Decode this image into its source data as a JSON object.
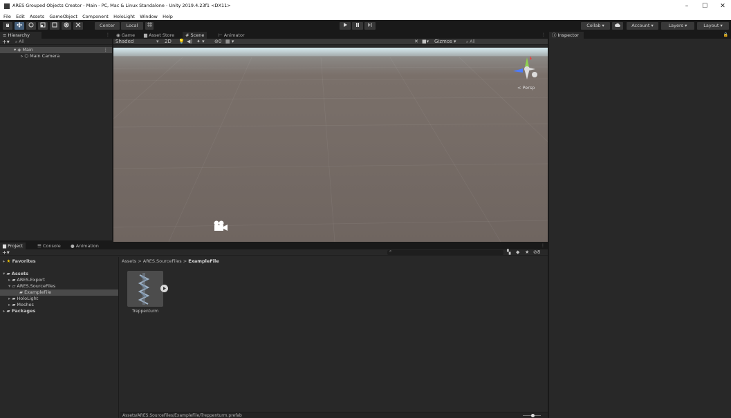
{
  "window": {
    "title": "ARES Grouped Objects Creator - Main - PC, Mac & Linux Standalone - Unity 2019.4.23f1 <DX11>",
    "minimize": "–",
    "maximize": "☐",
    "close": "✕"
  },
  "menu": [
    "File",
    "Edit",
    "Assets",
    "GameObject",
    "Component",
    "HoloLight",
    "Window",
    "Help"
  ],
  "toolbar": {
    "center_label": "Center",
    "local_label": "Local",
    "collab_label": "Collab ▾",
    "account_label": "Account",
    "layers_label": "Layers",
    "layout_label": "Layout"
  },
  "hierarchy": {
    "tab": "Hierarchy",
    "search_placeholder": "All",
    "items": [
      {
        "label": "Main"
      },
      {
        "label": "Main Camera"
      }
    ]
  },
  "scene": {
    "tabs": [
      "Game",
      "Asset Store",
      "Scene",
      "Animator"
    ],
    "shading_mode": "Shaded",
    "mode_2d": "2D",
    "fx_count": "0",
    "gizmos_label": "Gizmos",
    "search_placeholder": "All",
    "persp_label": "< Persp"
  },
  "inspector": {
    "tab": "Inspector"
  },
  "project": {
    "tabs": [
      "Project",
      "Console",
      "Animation"
    ],
    "favorites_label": "Favorites",
    "tree": [
      {
        "label": "Assets"
      },
      {
        "label": "ARES.Export"
      },
      {
        "label": "ARES.SourceFiles"
      },
      {
        "label": "ExampleFile"
      },
      {
        "label": "HoloLight"
      },
      {
        "label": "Meshes"
      },
      {
        "label": "Packages"
      }
    ],
    "breadcrumb": [
      "Assets",
      "ARES.SourceFiles",
      "ExampleFile"
    ],
    "breadcrumb_sep": ">",
    "asset_name": "Treppenturm",
    "status_path": "Assets/ARES.SourceFiles/ExampleFile/Treppenturm.prefab",
    "hidden_count": "8",
    "zoom_level": 0.55
  },
  "colors": {
    "accent": "#46607c",
    "selection": "#4a4a4a",
    "panel": "#282828",
    "background": "#191919"
  }
}
